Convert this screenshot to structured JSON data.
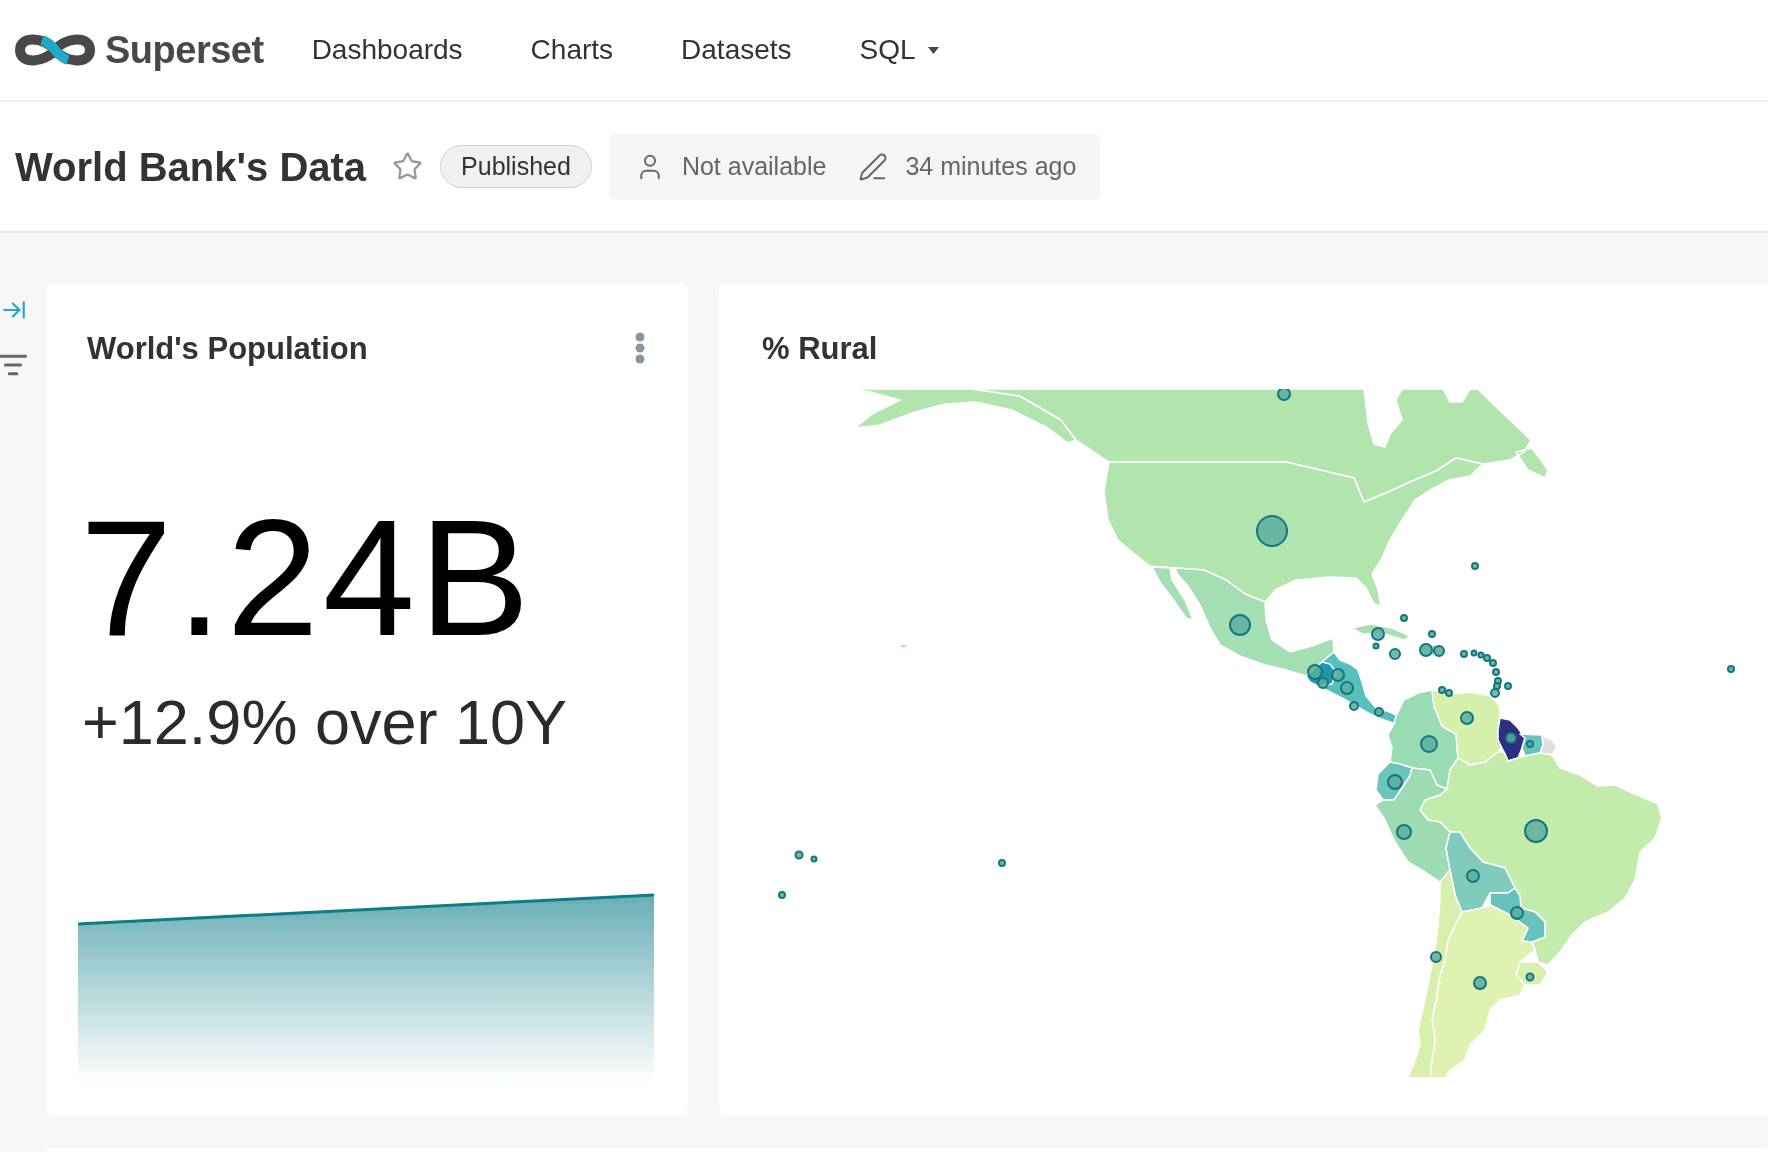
{
  "header": {
    "brand": "Superset",
    "nav": [
      {
        "label": "Dashboards",
        "kind": "link"
      },
      {
        "label": "Charts",
        "kind": "link"
      },
      {
        "label": "Datasets",
        "kind": "link"
      },
      {
        "label": "SQL",
        "kind": "dropdown"
      }
    ]
  },
  "dashboard": {
    "title": "World Bank's Data",
    "favorite": false,
    "status": "Published",
    "owner": "Not available",
    "modified": "34 minutes ago"
  },
  "charts": [
    {
      "kind": "big_number",
      "title": "World's Population",
      "value": "7.24B",
      "subheader": "+12.9% over 10Y"
    },
    {
      "kind": "map",
      "title": "% Rural"
    }
  ]
}
